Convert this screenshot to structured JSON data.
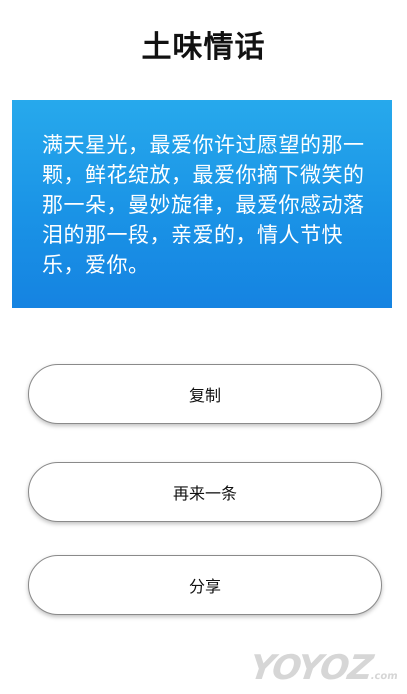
{
  "app": {
    "title": "土味情话"
  },
  "quote": {
    "text": "满天星光，最爱你许过愿望的那一颗，鲜花绽放，最爱你摘下微笑的那一朵，曼妙旋律，最爱你感动落泪的那一段，亲爱的，情人节快乐，爱你。"
  },
  "actions": {
    "copy_label": "复制",
    "next_label": "再来一条",
    "share_label": "分享"
  },
  "watermark": {
    "text": "YOYOZ",
    "suffix": ".com"
  },
  "colors": {
    "card_gradient_top": "#27a9ec",
    "card_gradient_bottom": "#1583e1",
    "button_border": "#8a8a8a"
  }
}
